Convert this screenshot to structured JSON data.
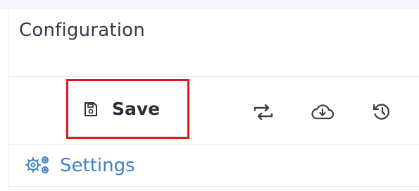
{
  "header": {
    "title": "Configuration"
  },
  "toolbar": {
    "save_label": "Save",
    "icons": [
      "save-icon",
      "swap-icon",
      "cloud-download-icon",
      "history-icon"
    ],
    "highlight_color": "#e3161b"
  },
  "nav": {
    "settings_label": "Settings",
    "settings_icon": "gears-icon",
    "link_color": "#3c82c6"
  }
}
